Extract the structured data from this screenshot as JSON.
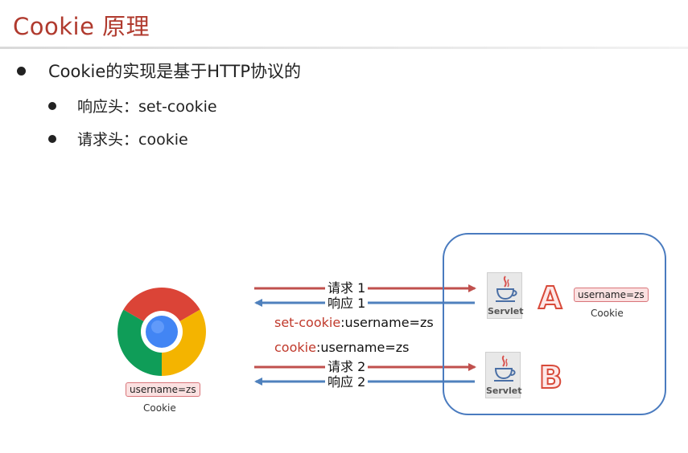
{
  "title": "Cookie 原理",
  "bullets": [
    "Cookie的实现是基于HTTP协议的",
    "响应头：set-cookie",
    "请求头：cookie"
  ],
  "arrows": {
    "request1": "请求 1",
    "response1": "响应 1",
    "request2": "请求 2",
    "response2": "响应 2"
  },
  "set_cookie": {
    "key": "set-cookie",
    "value": ":username=zs"
  },
  "cookie_header": {
    "key": "cookie",
    "value": ":username=zs"
  },
  "servlet_label": "Servlet",
  "server_a": "A",
  "server_b": "B",
  "browser_cookie": {
    "tag": "username=zs",
    "caption": "Cookie"
  },
  "server_cookie": {
    "tag": "username=zs",
    "caption": "Cookie"
  },
  "colors": {
    "title": "#b03a2e",
    "request": "#c0504d",
    "response": "#4f81bd",
    "box": "#4a7bbf"
  }
}
